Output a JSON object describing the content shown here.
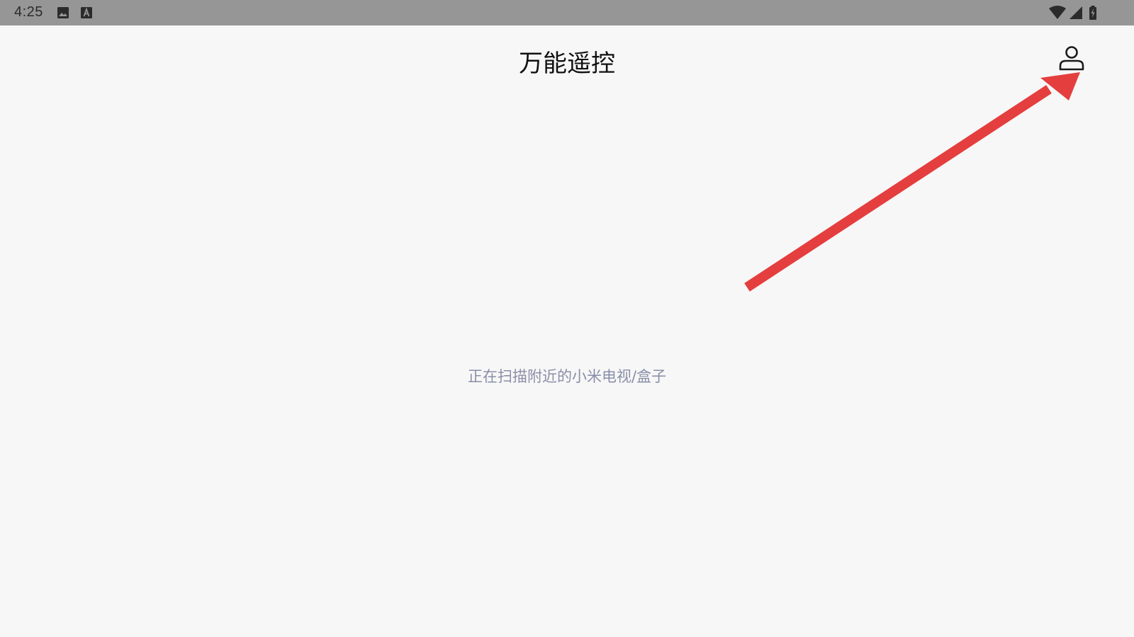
{
  "status_bar": {
    "time": "4:25",
    "left_icons": [
      "image-icon",
      "text-a-icon"
    ],
    "right_icons": [
      "wifi-icon",
      "cell-signal-icon",
      "battery-charging-icon"
    ]
  },
  "app_bar": {
    "title": "万能遥控",
    "profile_icon": "person-icon"
  },
  "main": {
    "scan_status": "正在扫描附近的小米电视/盒子"
  },
  "overlay": {
    "annotation": "red-arrow-pointing-to-profile",
    "color": "#e53e3e"
  },
  "colors": {
    "status_bar_bg": "#969696",
    "page_bg": "#f7f7f7",
    "scan_text": "#8a8fa8"
  }
}
